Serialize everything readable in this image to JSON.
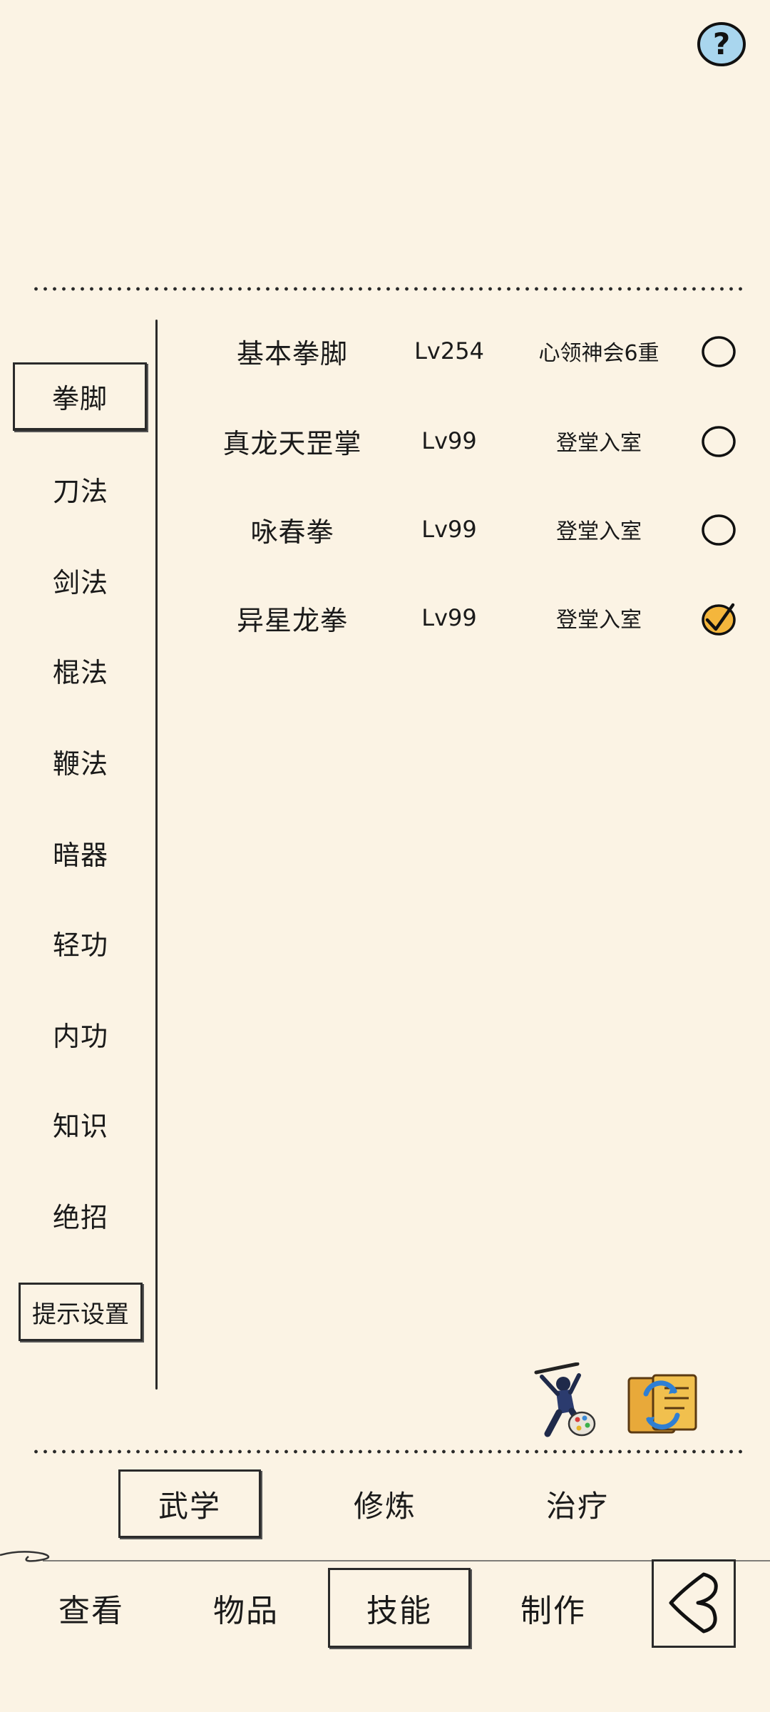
{
  "help": {
    "icon": "question-icon",
    "glyph": "?"
  },
  "sidebar": {
    "items": [
      {
        "label": "拳脚",
        "active": true
      },
      {
        "label": "刀法"
      },
      {
        "label": "剑法"
      },
      {
        "label": "棍法"
      },
      {
        "label": "鞭法"
      },
      {
        "label": "暗器"
      },
      {
        "label": "轻功"
      },
      {
        "label": "内功"
      },
      {
        "label": "知识"
      },
      {
        "label": "绝招"
      }
    ],
    "tip_button": "提示设置"
  },
  "skills": [
    {
      "name": "基本拳脚",
      "level": "Lv254",
      "rank": "心领神会6重",
      "checked": false
    },
    {
      "name": "真龙天罡掌",
      "level": "Lv99",
      "rank": "登堂入室",
      "checked": false
    },
    {
      "name": "咏春拳",
      "level": "Lv99",
      "rank": "登堂入室",
      "checked": false
    },
    {
      "name": "异星龙拳",
      "level": "Lv99",
      "rank": "登堂入室",
      "checked": true
    }
  ],
  "icons": {
    "martial_artist": "martial-artist-icon",
    "book_swap": "book-swap-icon",
    "checkmark": "checkmark-icon",
    "back": "back-arrow-icon"
  },
  "sub_tabs": [
    {
      "label": "武学",
      "active": true
    },
    {
      "label": "修炼"
    },
    {
      "label": "治疗"
    }
  ],
  "nav_tabs": [
    {
      "label": "查看"
    },
    {
      "label": "物品"
    },
    {
      "label": "技能",
      "active": true
    },
    {
      "label": "制作"
    }
  ],
  "colors": {
    "background": "#fbf3e4",
    "ink": "#1a1a1a",
    "check_fill": "#f4b63c"
  }
}
